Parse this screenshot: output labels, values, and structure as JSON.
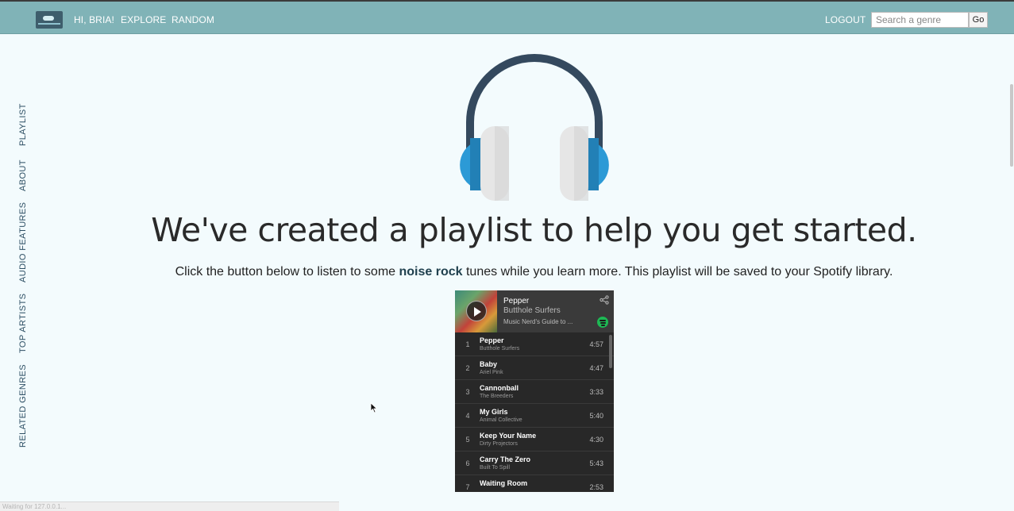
{
  "nav": {
    "greeting": "HI, BRIA!",
    "explore_label": "EXPLORE",
    "random_label": "RANDOM",
    "logout_label": "LOGOUT",
    "search_placeholder": "Search a genre",
    "go_label": "Go",
    "logo_icon": "cassette-tape-icon"
  },
  "sidebar": {
    "items": [
      {
        "label": "PLAYLIST"
      },
      {
        "label": "ABOUT"
      },
      {
        "label": "AUDIO FEATURES"
      },
      {
        "label": "TOP ARTISTS"
      },
      {
        "label": "RELATED GENRES"
      }
    ]
  },
  "main": {
    "headline": "We've created a playlist to help you get started.",
    "sub_before": "Click the button below to listen to some ",
    "genre": "noise rock",
    "sub_after": " tunes while you learn more. This playlist will be saved to your Spotify library.",
    "hero_icon": "headphones-icon"
  },
  "widget": {
    "title": "Pepper",
    "artist": "Butthole Surfers",
    "playlist": "Music Nerd's Guide to ...",
    "tracks": [
      {
        "num": "1",
        "name": "Pepper",
        "artist": "Butthole Surfers",
        "time": "4:57"
      },
      {
        "num": "2",
        "name": "Baby",
        "artist": "Ariel Pink",
        "time": "4:47"
      },
      {
        "num": "3",
        "name": "Cannonball",
        "artist": "The Breeders",
        "time": "3:33"
      },
      {
        "num": "4",
        "name": "My Girls",
        "artist": "Animal Collective",
        "time": "5:40"
      },
      {
        "num": "5",
        "name": "Keep Your Name",
        "artist": "Dirty Projectors",
        "time": "4:30"
      },
      {
        "num": "6",
        "name": "Carry The Zero",
        "artist": "Built To Spill",
        "time": "5:43"
      },
      {
        "num": "7",
        "name": "Waiting Room",
        "artist": "",
        "time": "2:53"
      }
    ]
  },
  "status": {
    "text": "Waiting for 127.0.0.1..."
  },
  "colors": {
    "topbar": "#80b3b7",
    "background": "#f3fbfd",
    "headphone_band": "#34495e",
    "headphone_cup": "#2c9ad6",
    "spotify_green": "#1db954"
  }
}
